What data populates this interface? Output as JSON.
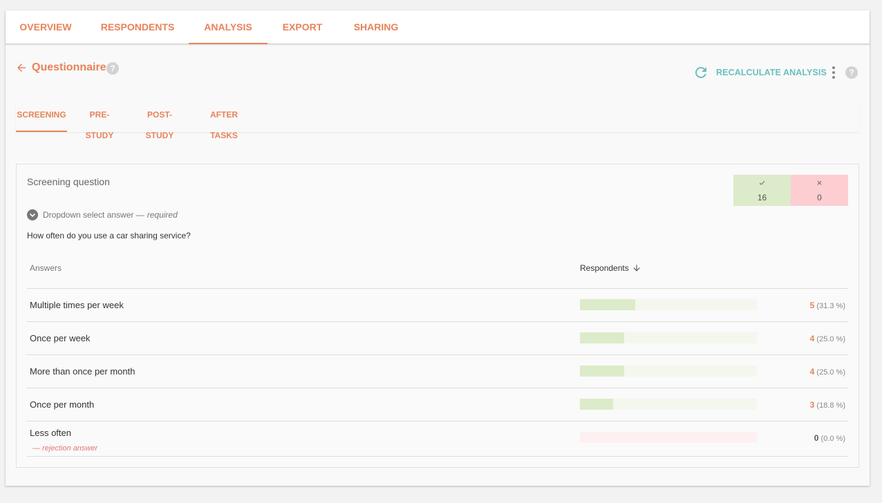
{
  "top_tabs": [
    "OVERVIEW",
    "RESPONDENTS",
    "ANALYSIS",
    "EXPORT",
    "SHARING"
  ],
  "active_top_tab": "ANALYSIS",
  "header": {
    "title": "Questionnaire",
    "help": "?",
    "recalc_label": "RECALCULATE ANALYSIS"
  },
  "sub_tabs": [
    "SCREENING",
    "PRE-STUDY",
    "POST-STUDY",
    "AFTER TASKS"
  ],
  "active_sub_tab": "SCREENING",
  "panel": {
    "title": "Screening question",
    "accepted_count": "16",
    "rejected_count": "0",
    "type_label": "Dropdown select answer —",
    "required_label": "required",
    "question": "How often do you use a car sharing service?",
    "col_answers": "Answers",
    "col_respondents": "Respondents"
  },
  "answers": [
    {
      "label": "Multiple times per week",
      "count": "5",
      "pct": "(31.3 %)",
      "share": 0.313,
      "rejection": ""
    },
    {
      "label": "Once per week",
      "count": "4",
      "pct": "(25.0 %)",
      "share": 0.25,
      "rejection": ""
    },
    {
      "label": "More than once per month",
      "count": "4",
      "pct": "(25.0 %)",
      "share": 0.25,
      "rejection": ""
    },
    {
      "label": "Once per month",
      "count": "3",
      "pct": "(18.8 %)",
      "share": 0.188,
      "rejection": ""
    },
    {
      "label": "Less often",
      "count": "0",
      "pct": "(0.0 %)",
      "share": 0,
      "rejection": "— rejection answer"
    }
  ],
  "colors": {
    "accent": "#e8825a",
    "teal": "#6bbfbf",
    "accept": "#dcebc9",
    "reject": "#fccdd1"
  },
  "icons": {
    "back": "arrow-left-icon",
    "recalc": "refresh-icon",
    "more": "more-vert-icon",
    "sort": "arrow-down-icon",
    "check": "check-icon",
    "close": "close-icon",
    "expand": "chevron-down-icon"
  }
}
